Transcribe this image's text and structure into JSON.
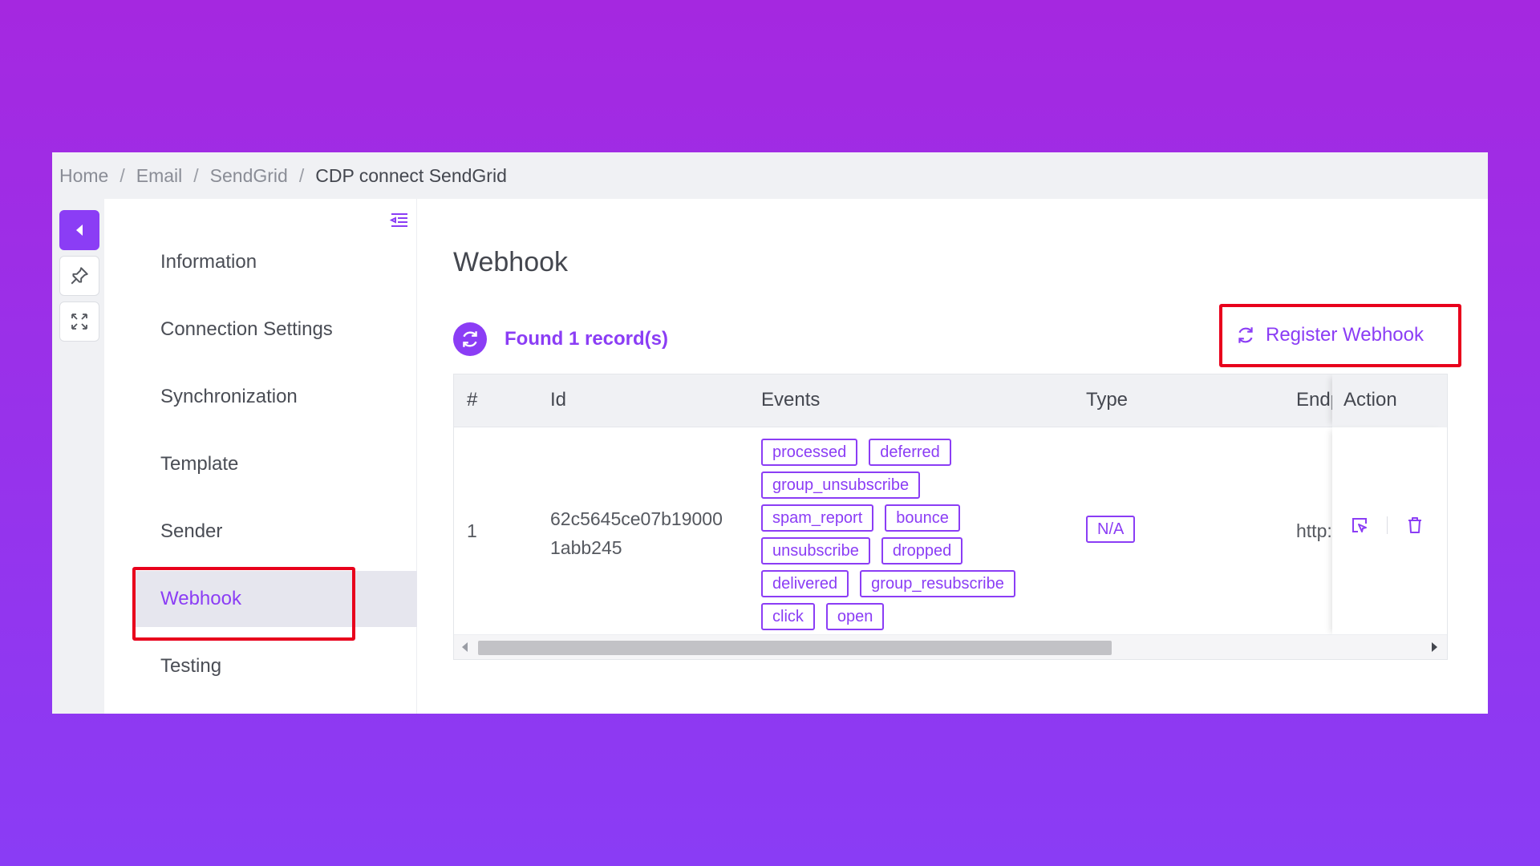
{
  "breadcrumb": [
    "Home",
    "Email",
    "SendGrid",
    "CDP connect SendGrid"
  ],
  "breadcrumb_separator": "/",
  "menu": {
    "items": [
      "Information",
      "Connection Settings",
      "Synchronization",
      "Template",
      "Sender",
      "Webhook",
      "Testing"
    ],
    "active": "Webhook"
  },
  "page": {
    "title": "Webhook",
    "found_text": "Found 1 record(s)",
    "register_label": "Register Webhook"
  },
  "table": {
    "headers": {
      "num": "#",
      "id": "Id",
      "events": "Events",
      "type": "Type",
      "endpoint": "Endp",
      "action": "Action"
    },
    "row": {
      "num": "1",
      "id_line1": "62c5645ce07b19000",
      "id_line2": "1abb245",
      "events": [
        "processed",
        "deferred",
        "group_unsubscribe",
        "spam_report",
        "bounce",
        "unsubscribe",
        "dropped",
        "delivered",
        "group_resubscribe",
        "click",
        "open"
      ],
      "type": "N/A",
      "endpoint": "http:"
    }
  },
  "colors": {
    "accent": "#8b3df5",
    "highlight": "#e8001c",
    "panel_bg": "#f0f1f4"
  }
}
